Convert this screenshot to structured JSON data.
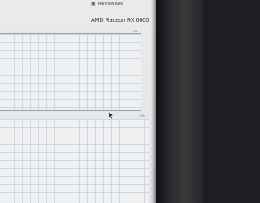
{
  "toolbar": {
    "run_new_task_label": "Run new task",
    "run_icon": "run-task-icon",
    "more_icon": "more-options-icon"
  },
  "gpu": {
    "name": "AMD Radeon RX 6600"
  },
  "graphs": [
    {
      "max_label": "0%"
    },
    {
      "max_label": "0%"
    }
  ],
  "colors": {
    "panel_bg": "#e9eaec",
    "grid_line": "#cfd7dc",
    "graph_border": "#9aa1a8",
    "bezel": "#2a2a2e"
  }
}
